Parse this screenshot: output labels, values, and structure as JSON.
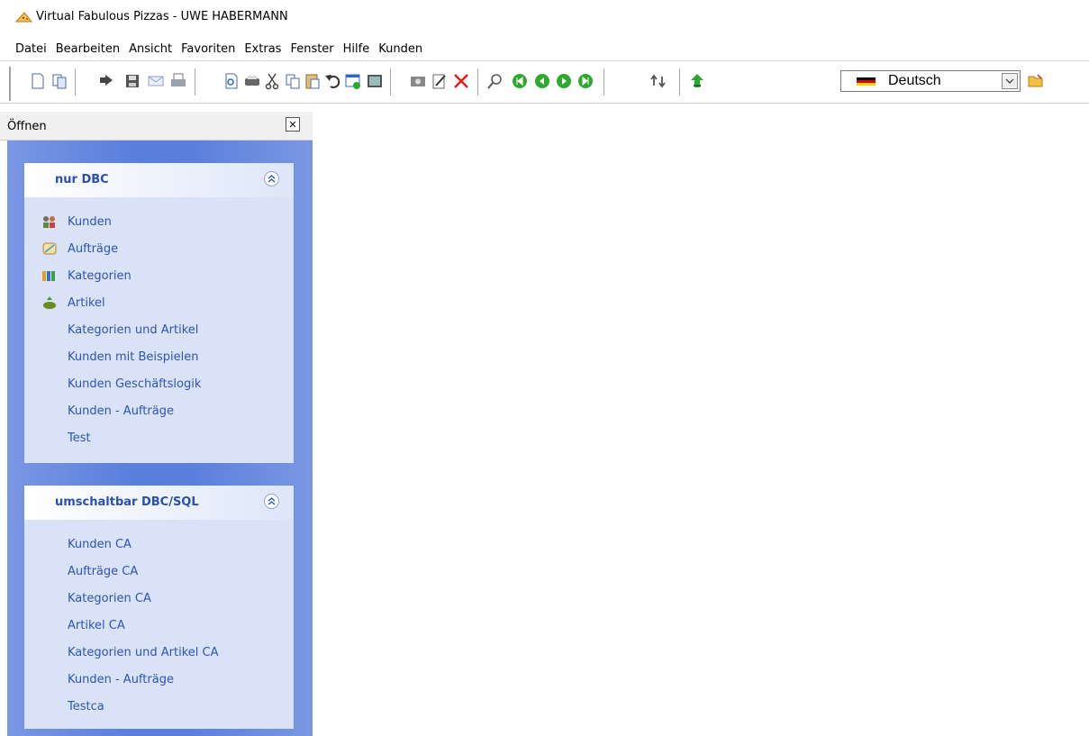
{
  "window": {
    "title": "Virtual Fabulous Pizzas - UWE HABERMANN"
  },
  "menu": [
    "Datei",
    "Bearbeiten",
    "Ansicht",
    "Favoriten",
    "Extras",
    "Fenster",
    "Hilfe",
    "Kunden"
  ],
  "toolbar": {
    "language_selected": "Deutsch",
    "icons": [
      "new-icon",
      "copy-icon",
      "open-icon",
      "save-icon",
      "mail-icon",
      "print-icon",
      "preview-icon",
      "printer-icon",
      "cut-icon",
      "copy-doc-icon",
      "paste-icon",
      "undo-icon",
      "save-record-icon",
      "image-icon",
      "camera-icon",
      "edit-icon",
      "delete-icon",
      "search-icon",
      "first-record-icon",
      "previous-record-icon",
      "next-record-icon",
      "last-record-icon",
      "refresh-icon",
      "upload-icon",
      "language-flag-icon",
      "folder-icon"
    ],
    "colors": {
      "nav_green": "#2fa82f",
      "delete_red": "#e02020"
    }
  },
  "sidebar": {
    "header": "Öffnen",
    "colors": {
      "panel_blue": "#5a7fdc",
      "group_bg": "#d9e2f7",
      "link_blue": "#2e54b6",
      "title_blue": "#2950b0"
    },
    "groups": [
      {
        "title": "nur DBC",
        "items": [
          {
            "label": "Kunden",
            "icon": "customers-icon"
          },
          {
            "label": "Aufträge",
            "icon": "orders-icon"
          },
          {
            "label": "Kategorien",
            "icon": "categories-icon"
          },
          {
            "label": "Artikel",
            "icon": "articles-icon"
          },
          {
            "label": "Kategorien und Artikel"
          },
          {
            "label": "Kunden mit Beispielen"
          },
          {
            "label": "Kunden Geschäftslogik"
          },
          {
            "label": "Kunden - Aufträge"
          },
          {
            "label": "Test"
          }
        ]
      },
      {
        "title": "umschaltbar DBC/SQL",
        "items": [
          {
            "label": "Kunden CA"
          },
          {
            "label": "Aufträge CA"
          },
          {
            "label": "Kategorien CA"
          },
          {
            "label": "Artikel CA"
          },
          {
            "label": "Kategorien und Artikel CA"
          },
          {
            "label": "Kunden - Aufträge"
          },
          {
            "label": "Testca"
          }
        ]
      }
    ]
  }
}
